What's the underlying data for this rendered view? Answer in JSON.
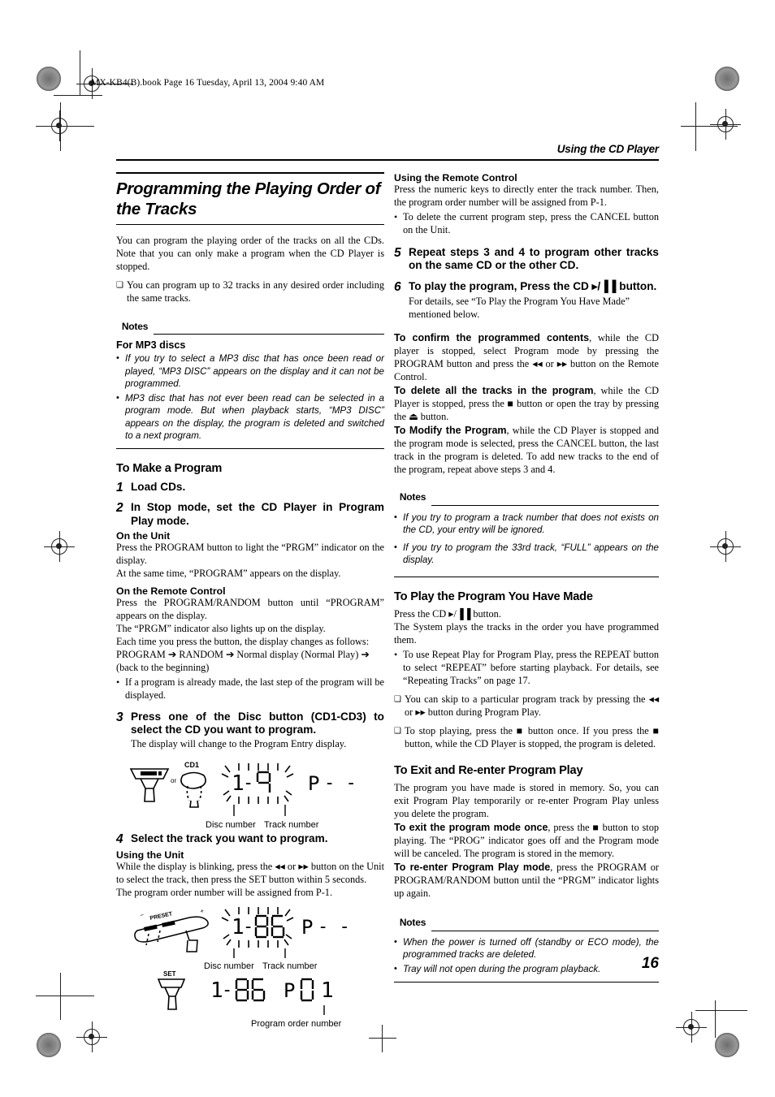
{
  "fileinfo": "MX-KB4(B).book  Page 16  Tuesday, April 13, 2004  9:40 AM",
  "running_head": "Using the CD Player",
  "page_number": "16",
  "left": {
    "title": "Programming the Playing Order of the Tracks",
    "intro": "You can program the playing order of the tracks on all the CDs. Note that you can only make a program when the CD Player is stopped.",
    "intro_bullet": "You can program up to 32 tracks in any desired order including the same tracks.",
    "notes_label": "Notes",
    "notes_heading": "For MP3 discs",
    "notes": [
      "If you try to select a MP3 disc that has once been read or played, “MP3 DISC” appears on the display and it can not be programmed.",
      "MP3 disc that has not ever been read can be selected in a program mode. But when playback starts, “MP3 DISC” appears on the display, the program is deleted and switched to a next program."
    ],
    "section_heading": "To Make a Program",
    "step1_num": "1",
    "step1_text": "Load CDs.",
    "step2_num": "2",
    "step2_text": "In Stop mode, set the CD Player in Program Play mode.",
    "on_the_unit": "On the Unit",
    "unit_p1": "Press the PROGRAM button to light the “PRGM” indicator on the display.",
    "unit_p2": "At the same time, “PROGRAM” appears on the display.",
    "on_the_remote": "On the Remote Control",
    "remote_p1": "Press the PROGRAM/RANDOM button until “PROGRAM” appears on the display.",
    "remote_p2": "The “PRGM” indicator also lights up on the display.",
    "remote_p3": "Each time you press the button, the display changes as follows:",
    "remote_cycle": "PROGRAM ➔ RANDOM ➔ Normal display (Normal Play) ➔ (back to the beginning)",
    "remote_bullet": "If a program is already made, the last step of the program will be displayed.",
    "step3_num": "3",
    "step3_text": "Press one of the Disc button (CD1-CD3) to select the CD you want to program.",
    "step3_sub": "The display will change to the Program Entry display.",
    "fig1": {
      "button_label": "CD 1",
      "or_label": "or",
      "remote_label": "CD1",
      "lcd_disc": "1",
      "lcd_dash": "-",
      "lcd_track": "- -",
      "lcd_prog": "P - -",
      "caption_disc": "Disc number",
      "caption_track": "Track number"
    },
    "step4_num": "4",
    "step4_text": "Select the track you want to program.",
    "using_the_unit": "Using the Unit",
    "step4_p1": "While the display is blinking, press the ◂◂ or ▸▸ button on the Unit to select the track, then press the SET button within 5 seconds.",
    "step4_p2": "The program order number will be assigned from P-1.",
    "fig2": {
      "unit_label": "PRESET",
      "lcd_disc": "1",
      "lcd_dash": "-",
      "lcd_track": "06",
      "lcd_prog": "P - -",
      "caption_disc": "Disc number",
      "caption_track": "Track number"
    },
    "fig3": {
      "set_label": "SET",
      "lcd_full": "1-06  P01",
      "caption_program": "Program order number"
    }
  },
  "right": {
    "remote_heading": "Using the Remote Control",
    "remote_p1": "Press the numeric keys to directly enter the track number. Then, the program order number will be assigned from P-1.",
    "remote_bullet": "To delete the current program step, press the CANCEL button on the Unit.",
    "step5_num": "5",
    "step5_text": "Repeat steps 3 and 4 to program other tracks on the same CD or the other CD.",
    "step6_num": "6",
    "step6_text_a": "To play the program, Press the CD ",
    "step6_icon": "▸/▐▐",
    "step6_text_b": " button.",
    "step6_sub": "For details, see “To Play the Program You Have Made” mentioned below.",
    "confirm_bold": "To confirm the programmed contents",
    "confirm_rest": ", while the CD player is stopped, select Program mode by pressing the PROGRAM button and press the ◂◂ or ▸▸ button on the Remote Control.",
    "deleteall_bold": "To delete all the tracks in the program",
    "deleteall_rest": ", while the CD Player is stopped, press the ■ button or open the tray by pressing the ⏏ button.",
    "modify_bold": "To Modify the Program",
    "modify_rest": ", while the CD Player is stopped and the program mode is selected, press the CANCEL button, the last track in the program is deleted. To add new tracks to the end of the program, repeat above steps 3 and 4.",
    "notes_label": "Notes",
    "notes": [
      "If you try to program a track number that does not exists on the CD, your entry will be ignored.",
      "If you try to program the 33rd track, “FULL” appears on the display."
    ],
    "play_heading": "To Play the Program You Have Made",
    "play_p1_a": "Press the CD ",
    "play_p1_icon": "▸/▐▐",
    "play_p1_b": " button.",
    "play_p2": "The System plays the tracks in the order you have programmed them.",
    "play_bullet": "To use Repeat Play for Program Play, press the REPEAT button to select “REPEAT” before starting playback. For details, see “Repeating Tracks” on page 17.",
    "play_sq1": "You can skip to a particular program track by pressing the ◂◂ or ▸▸ button during Program Play.",
    "play_sq2": "To stop playing, press the ■ button once. If you press the ■ button, while the CD Player is stopped, the program is deleted.",
    "exit_heading": "To Exit and Re-enter Program Play",
    "exit_p1": "The program you have made is stored in memory. So, you can exit Program Play temporarily or re-enter Program Play unless you delete the program.",
    "exit_bold": "To exit the program mode once",
    "exit_rest": ", press the ■ button to stop playing. The “PROG” indicator goes off and the Program mode will be canceled. The program is stored in the memory.",
    "reenter_bold": "To re-enter Program Play mode",
    "reenter_rest": ", press the PROGRAM or PROGRAM/RANDOM button until the “PRGM” indicator lights up again.",
    "notes2_label": "Notes",
    "notes2": [
      "When the power is turned off (standby or ECO mode), the programmed tracks are deleted.",
      "Tray will not open during the program playback."
    ]
  }
}
